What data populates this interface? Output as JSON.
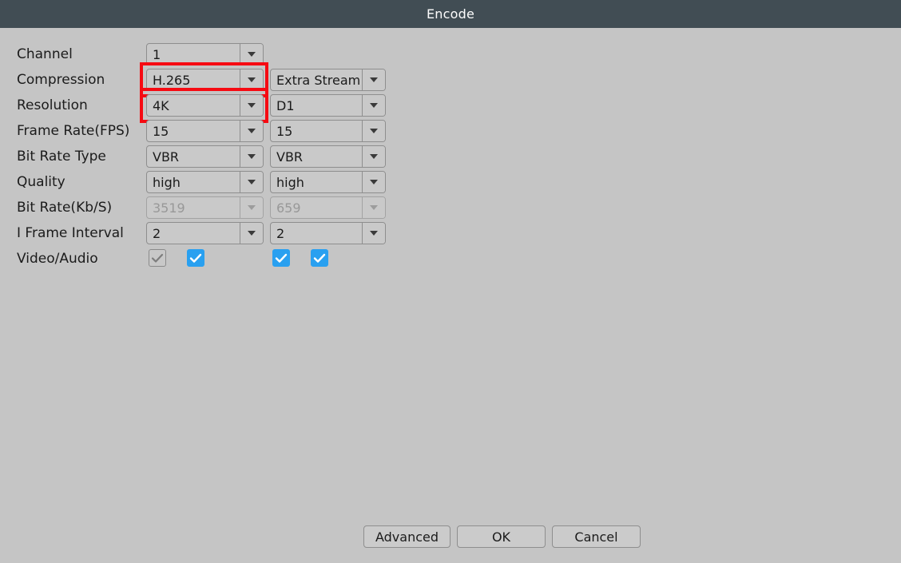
{
  "window": {
    "title": "Encode",
    "titlebar_color": "#414d54",
    "background_color": "#c5c5c5",
    "accent_checkbox_color": "#29a0f0",
    "highlight_color": "#f60a12"
  },
  "form": {
    "rows": [
      {
        "label": "Channel",
        "main": {
          "value": "1",
          "disabled": false,
          "highlighted": false
        },
        "sub": null
      },
      {
        "label": "Compression",
        "main": {
          "value": "H.265",
          "disabled": false,
          "highlighted": true
        },
        "sub": {
          "value": "Extra Stream",
          "disabled": false,
          "highlighted": false
        }
      },
      {
        "label": "Resolution",
        "main": {
          "value": "4K",
          "disabled": false,
          "highlighted": true
        },
        "sub": {
          "value": "D1",
          "disabled": false,
          "highlighted": false
        }
      },
      {
        "label": "Frame Rate(FPS)",
        "main": {
          "value": "15",
          "disabled": false,
          "highlighted": false
        },
        "sub": {
          "value": "15",
          "disabled": false,
          "highlighted": false
        }
      },
      {
        "label": "Bit Rate Type",
        "main": {
          "value": "VBR",
          "disabled": false,
          "highlighted": false
        },
        "sub": {
          "value": "VBR",
          "disabled": false,
          "highlighted": false
        }
      },
      {
        "label": "Quality",
        "main": {
          "value": "high",
          "disabled": false,
          "highlighted": false
        },
        "sub": {
          "value": "high",
          "disabled": false,
          "highlighted": false
        }
      },
      {
        "label": "Bit Rate(Kb/S)",
        "main": {
          "value": "3519",
          "disabled": true,
          "highlighted": false
        },
        "sub": {
          "value": "659",
          "disabled": true,
          "highlighted": false
        }
      },
      {
        "label": "I Frame Interval",
        "main": {
          "value": "2",
          "disabled": false,
          "highlighted": false
        },
        "sub": {
          "value": "2",
          "disabled": false,
          "highlighted": false
        }
      }
    ],
    "video_audio": {
      "label": "Video/Audio",
      "checkboxes": [
        {
          "name": "main-video",
          "checked": true,
          "disabled": true
        },
        {
          "name": "main-audio",
          "checked": true,
          "disabled": false
        },
        {
          "name": "sub-video",
          "checked": true,
          "disabled": false
        },
        {
          "name": "sub-audio",
          "checked": true,
          "disabled": false
        }
      ]
    }
  },
  "footer": {
    "advanced_label": "Advanced",
    "ok_label": "OK",
    "cancel_label": "Cancel"
  }
}
